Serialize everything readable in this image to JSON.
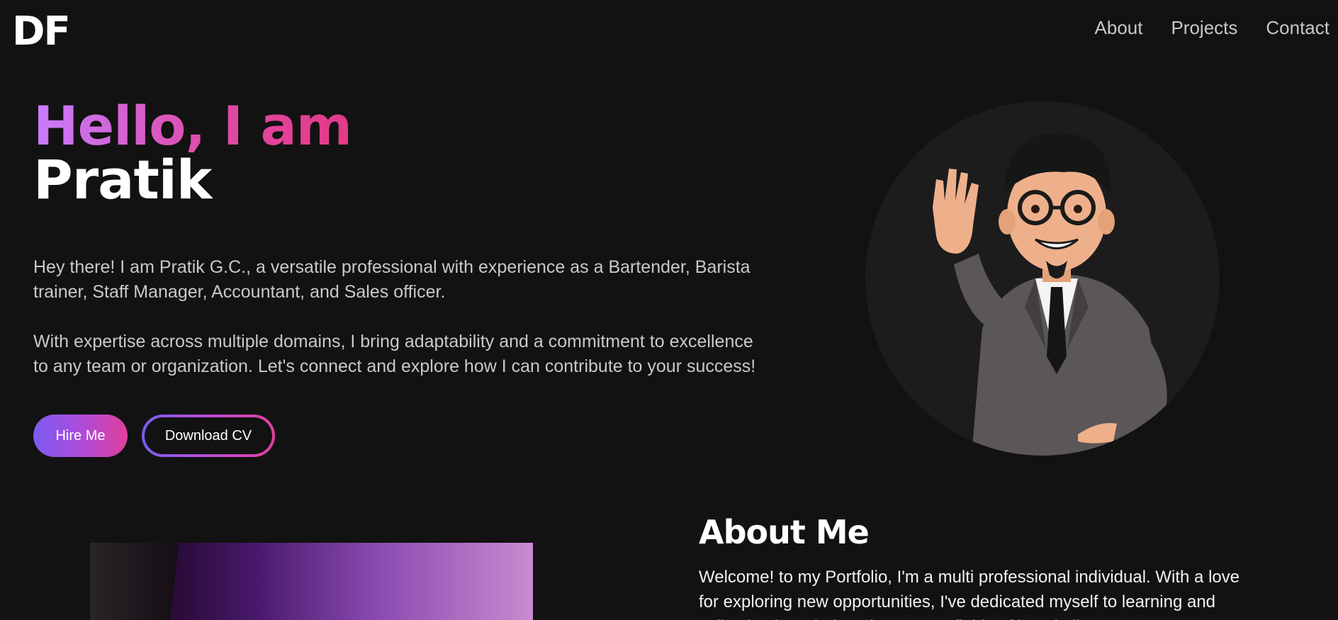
{
  "brand": {
    "logo": "DF"
  },
  "nav": {
    "items": [
      "About",
      "Projects",
      "Contact"
    ]
  },
  "hero": {
    "greeting": "Hello, I am",
    "name": "Pratik",
    "paragraph1": "Hey there! I am Pratik G.C., a versatile professional with experience as a Bartender, Barista trainer, Staff Manager, Accountant, and Sales officer.",
    "paragraph2": "With expertise across multiple domains, I bring adaptability and a commitment to excellence to any team or organization. Let's connect and explore how I can contribute to your success!",
    "hire_label": "Hire Me",
    "cv_label": "Download CV"
  },
  "about": {
    "title": "About Me",
    "text": "Welcome! to my Portfolio, I'm a multi professional individual. With a love for exploring new opportunities, I've dedicated myself to learning and collecting knowledge about many fields of hospitality."
  },
  "colors": {
    "background": "#121212",
    "accent_start": "#7a5cf0",
    "accent_mid": "#c77dff",
    "accent_end": "#e0409a"
  },
  "icons": [
    "avatar-illustration"
  ]
}
